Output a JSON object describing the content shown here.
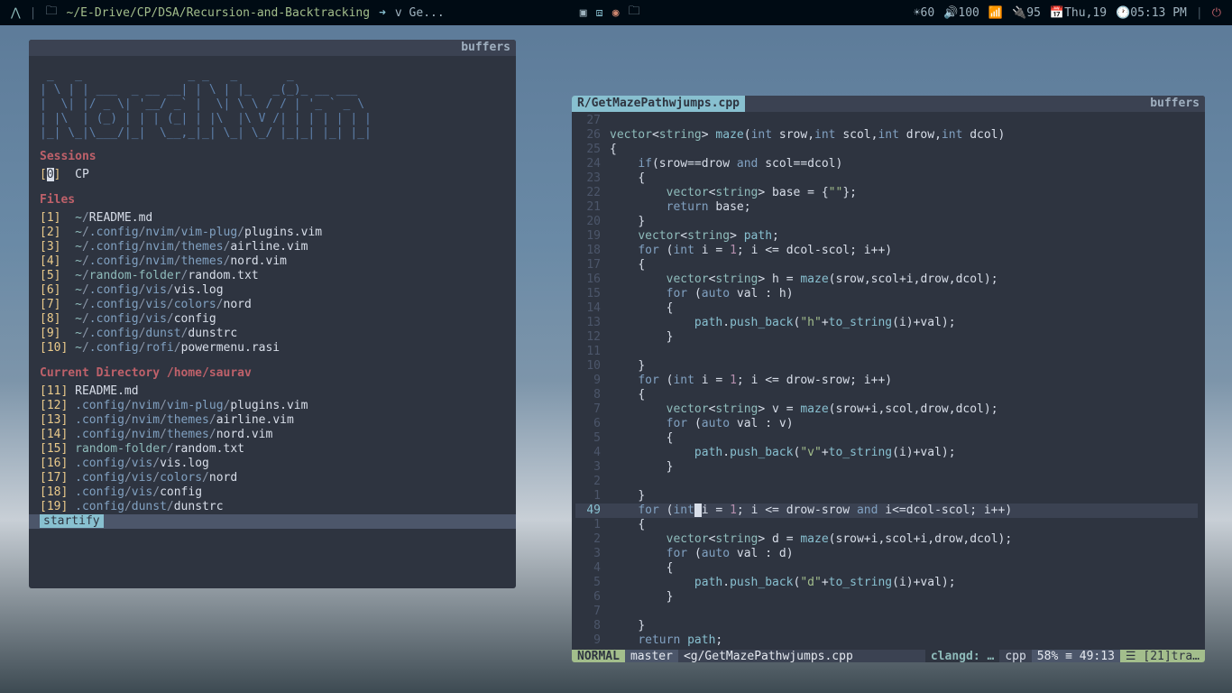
{
  "topbar": {
    "folder_icon": "🗀",
    "cwd_home": "~/E-Drive/CP/DSA/Recursion-and-Backtracking",
    "arrow": "➜",
    "cmd": "v Ge...",
    "brightness": {
      "icon": "☀",
      "value": "60"
    },
    "volume": {
      "icon": "🔊",
      "value": "100"
    },
    "wifi_icon": "📶",
    "battery": {
      "icon": "🔌",
      "value": "95"
    },
    "date": {
      "icon": "📅",
      "value": "Thu,19"
    },
    "clock": {
      "icon": "🕐",
      "value": "05:13 PM"
    },
    "power_icon": "⏻"
  },
  "left_pane": {
    "buffers_label": "buffers",
    "logo": " _   _               _ _   _       _            \n| \\ | | ___  _ __ __| | \\ | |_   _(_)_ __ ___  \n|  \\| |/ _ \\| '__/ _` |  \\| \\ \\ / / | '_ ` _ \\ \n| |\\  | (_) | | | (_| | |\\  |\\ V /| | | | | | |\n|_| \\_|\\___/|_|  \\__,_|_| \\_| \\_/ |_|_| |_| |_|",
    "sessions_label": "Sessions",
    "session_entry": {
      "idx": "0",
      "label": "CP"
    },
    "files_label": "Files",
    "files": [
      {
        "idx": "1",
        "segs": [
          "~",
          "README.md"
        ]
      },
      {
        "idx": "2",
        "segs": [
          "~",
          ".config",
          "nvim",
          "vim-plug",
          "plugins.vim"
        ]
      },
      {
        "idx": "3",
        "segs": [
          "~",
          ".config",
          "nvim",
          "themes",
          "airline.vim"
        ]
      },
      {
        "idx": "4",
        "segs": [
          "~",
          ".config",
          "nvim",
          "themes",
          "nord.vim"
        ]
      },
      {
        "idx": "5",
        "segs": [
          "~",
          "random-folder",
          "random.txt"
        ]
      },
      {
        "idx": "6",
        "segs": [
          "~",
          ".config",
          "vis",
          "vis.log"
        ]
      },
      {
        "idx": "7",
        "segs": [
          "~",
          ".config",
          "vis",
          "colors",
          "nord"
        ]
      },
      {
        "idx": "8",
        "segs": [
          "~",
          ".config",
          "vis",
          "config"
        ]
      },
      {
        "idx": "9",
        "segs": [
          "~",
          ".config",
          "dunst",
          "dunstrc"
        ]
      },
      {
        "idx": "10",
        "segs": [
          "~",
          ".config",
          "rofi",
          "powermenu.rasi"
        ]
      }
    ],
    "curdir_label": "Current Directory /home/saurav",
    "cdir": [
      {
        "idx": "11",
        "segs": [
          "README.md"
        ]
      },
      {
        "idx": "12",
        "segs": [
          ".config",
          "nvim",
          "vim-plug",
          "plugins.vim"
        ]
      },
      {
        "idx": "13",
        "segs": [
          ".config",
          "nvim",
          "themes",
          "airline.vim"
        ]
      },
      {
        "idx": "14",
        "segs": [
          ".config",
          "nvim",
          "themes",
          "nord.vim"
        ]
      },
      {
        "idx": "15",
        "segs": [
          "random-folder",
          "random.txt"
        ]
      },
      {
        "idx": "16",
        "segs": [
          ".config",
          "vis",
          "vis.log"
        ]
      },
      {
        "idx": "17",
        "segs": [
          ".config",
          "vis",
          "colors",
          "nord"
        ]
      },
      {
        "idx": "18",
        "segs": [
          ".config",
          "vis",
          "config"
        ]
      },
      {
        "idx": "19",
        "segs": [
          ".config",
          "dunst",
          "dunstrc"
        ]
      }
    ],
    "startify_label": "startify"
  },
  "right_pane": {
    "tab_label": "R/GetMazePathwjumps.cpp",
    "buffers_label": "buffers",
    "gutters": [
      "27",
      "26",
      "25",
      "24",
      "23",
      "22",
      "21",
      "20",
      "19",
      "18",
      "17",
      "16",
      "15",
      "14",
      "13",
      "12",
      "11",
      "10",
      "9",
      "8",
      "7",
      "6",
      "5",
      "4",
      "3",
      "2",
      "1",
      "49",
      "1",
      "2",
      "3",
      "4",
      "5",
      "6",
      "7",
      "8",
      "9"
    ],
    "status": {
      "mode": "NORMAL",
      "git": " master",
      "file": "<g/GetMazePathwjumps.cpp",
      "clangd": "clangd: …",
      "ft": "cpp",
      "pos": "58% ≡ 49:13",
      "end": "☰ [21]tra…"
    }
  }
}
